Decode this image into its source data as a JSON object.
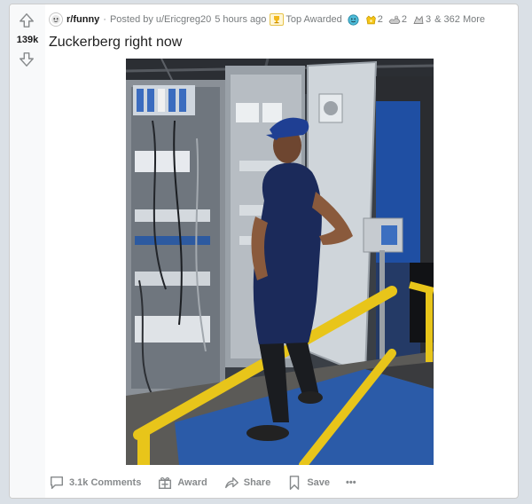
{
  "post": {
    "score": "139k",
    "subreddit": "r/funny",
    "meta_separator": "·",
    "posted_prefix": "Posted by",
    "author": "u/Ericgreg20",
    "time_ago": "5 hours ago",
    "top_award_label": "Top Awarded",
    "awards": [
      {
        "icon": "wholesome-award-icon",
        "count": ""
      },
      {
        "icon": "gold-award-icon",
        "count": "2"
      },
      {
        "icon": "helpful-award-icon",
        "count": "2"
      },
      {
        "icon": "silver-award-icon",
        "count": "3"
      }
    ],
    "more_awards": "& 362 More",
    "title": "Zuckerberg right now"
  },
  "actions": {
    "comments": "3.1k Comments",
    "award": "Award",
    "share": "Share",
    "save": "Save",
    "more": "•••"
  },
  "colors": {
    "background": "#dae0e6",
    "card": "#ffffff",
    "vote_column": "#f8f9fa",
    "meta_text": "#787c7e",
    "action_text": "#878a8c",
    "rail_yellow": "#e8c51a",
    "floor_blue": "#2b5ba8"
  }
}
